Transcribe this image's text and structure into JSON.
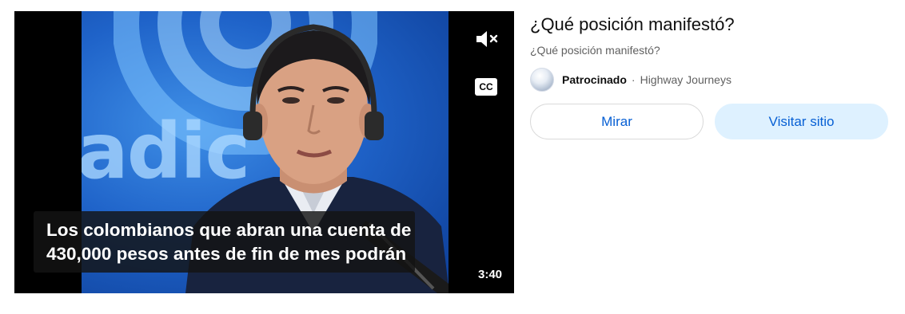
{
  "video": {
    "caption_lines": [
      "Los colombianos que abran una cuenta de",
      "430,000 pesos antes de fin de mes podrán"
    ],
    "duration": "3:40",
    "cc_label": "CC",
    "mute_icon": "speaker-muted-icon"
  },
  "ad": {
    "headline": "¿Qué posición manifestó?",
    "description": "¿Qué posición manifestó?",
    "sponsored_label": "Patrocinado",
    "separator": "·",
    "advertiser": "Highway Journeys",
    "watch_button": "Mirar",
    "visit_button": "Visitar sitio"
  },
  "colors": {
    "link_blue": "#065fd4",
    "visit_button_bg": "#def1ff",
    "secondary_text": "#606060"
  }
}
